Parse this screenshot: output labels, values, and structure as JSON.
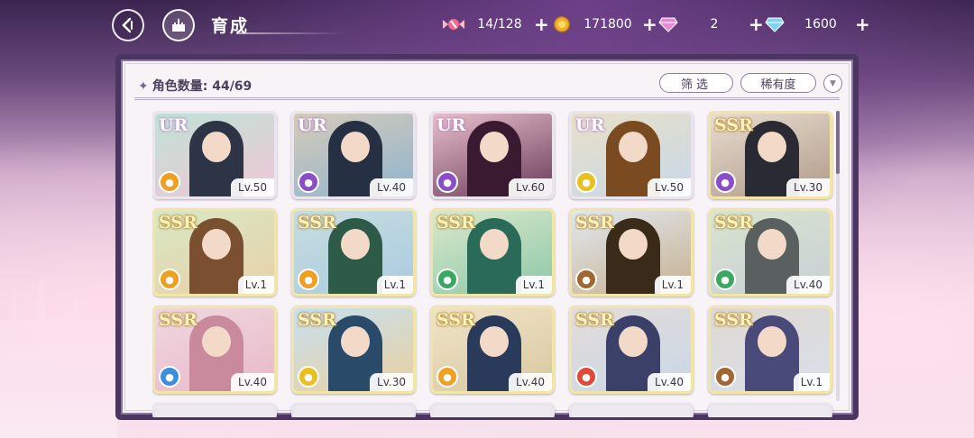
{
  "header": {
    "title": "育成",
    "resources": [
      {
        "icon": "candy-icon",
        "value": "14/128"
      },
      {
        "icon": "gold-coin-icon",
        "value": "171800"
      },
      {
        "icon": "pink-gem-icon",
        "value": "2"
      },
      {
        "icon": "blue-diamond-icon",
        "value": "1600"
      }
    ],
    "plus_label": "+"
  },
  "panel": {
    "count_label": "角色数量: 44/69",
    "filter_label": "筛选",
    "rarity_label": "稀有度"
  },
  "colors": {
    "panel_border": "#4a3660",
    "accent": "#8b7da0",
    "ur_glow": "#b37ec4",
    "ssr_glow": "#b08224"
  },
  "cards": [
    {
      "rarity": "UR",
      "level": "Lv.50",
      "element": "orange",
      "elem_icon": "scepter-icon"
    },
    {
      "rarity": "UR",
      "level": "Lv.40",
      "element": "purple",
      "elem_icon": "boot-icon"
    },
    {
      "rarity": "UR",
      "level": "Lv.60",
      "element": "purple",
      "elem_icon": "fist-icon"
    },
    {
      "rarity": "UR",
      "level": "Lv.50",
      "element": "yellow",
      "elem_icon": "crown-icon"
    },
    {
      "rarity": "SSR",
      "level": "Lv.30",
      "element": "purple",
      "elem_icon": "boot-icon"
    },
    {
      "rarity": "SSR",
      "level": "Lv.1",
      "element": "orange",
      "elem_icon": "fist-icon"
    },
    {
      "rarity": "SSR",
      "level": "Lv.1",
      "element": "orange",
      "elem_icon": "book-icon"
    },
    {
      "rarity": "SSR",
      "level": "Lv.1",
      "element": "green",
      "elem_icon": "boot-icon"
    },
    {
      "rarity": "SSR",
      "level": "Lv.1",
      "element": "brown",
      "elem_icon": "fist-icon"
    },
    {
      "rarity": "SSR",
      "level": "Lv.40",
      "element": "green",
      "elem_icon": "scepter-icon"
    },
    {
      "rarity": "SSR",
      "level": "Lv.40",
      "element": "blue",
      "elem_icon": "scepter-icon"
    },
    {
      "rarity": "SSR",
      "level": "Lv.30",
      "element": "yellow",
      "elem_icon": "book-icon"
    },
    {
      "rarity": "SSR",
      "level": "Lv.40",
      "element": "orange",
      "elem_icon": "fist-icon"
    },
    {
      "rarity": "SSR",
      "level": "Lv.40",
      "element": "red",
      "elem_icon": "book-icon"
    },
    {
      "rarity": "SSR",
      "level": "Lv.1",
      "element": "brown",
      "elem_icon": "shield-icon"
    }
  ]
}
